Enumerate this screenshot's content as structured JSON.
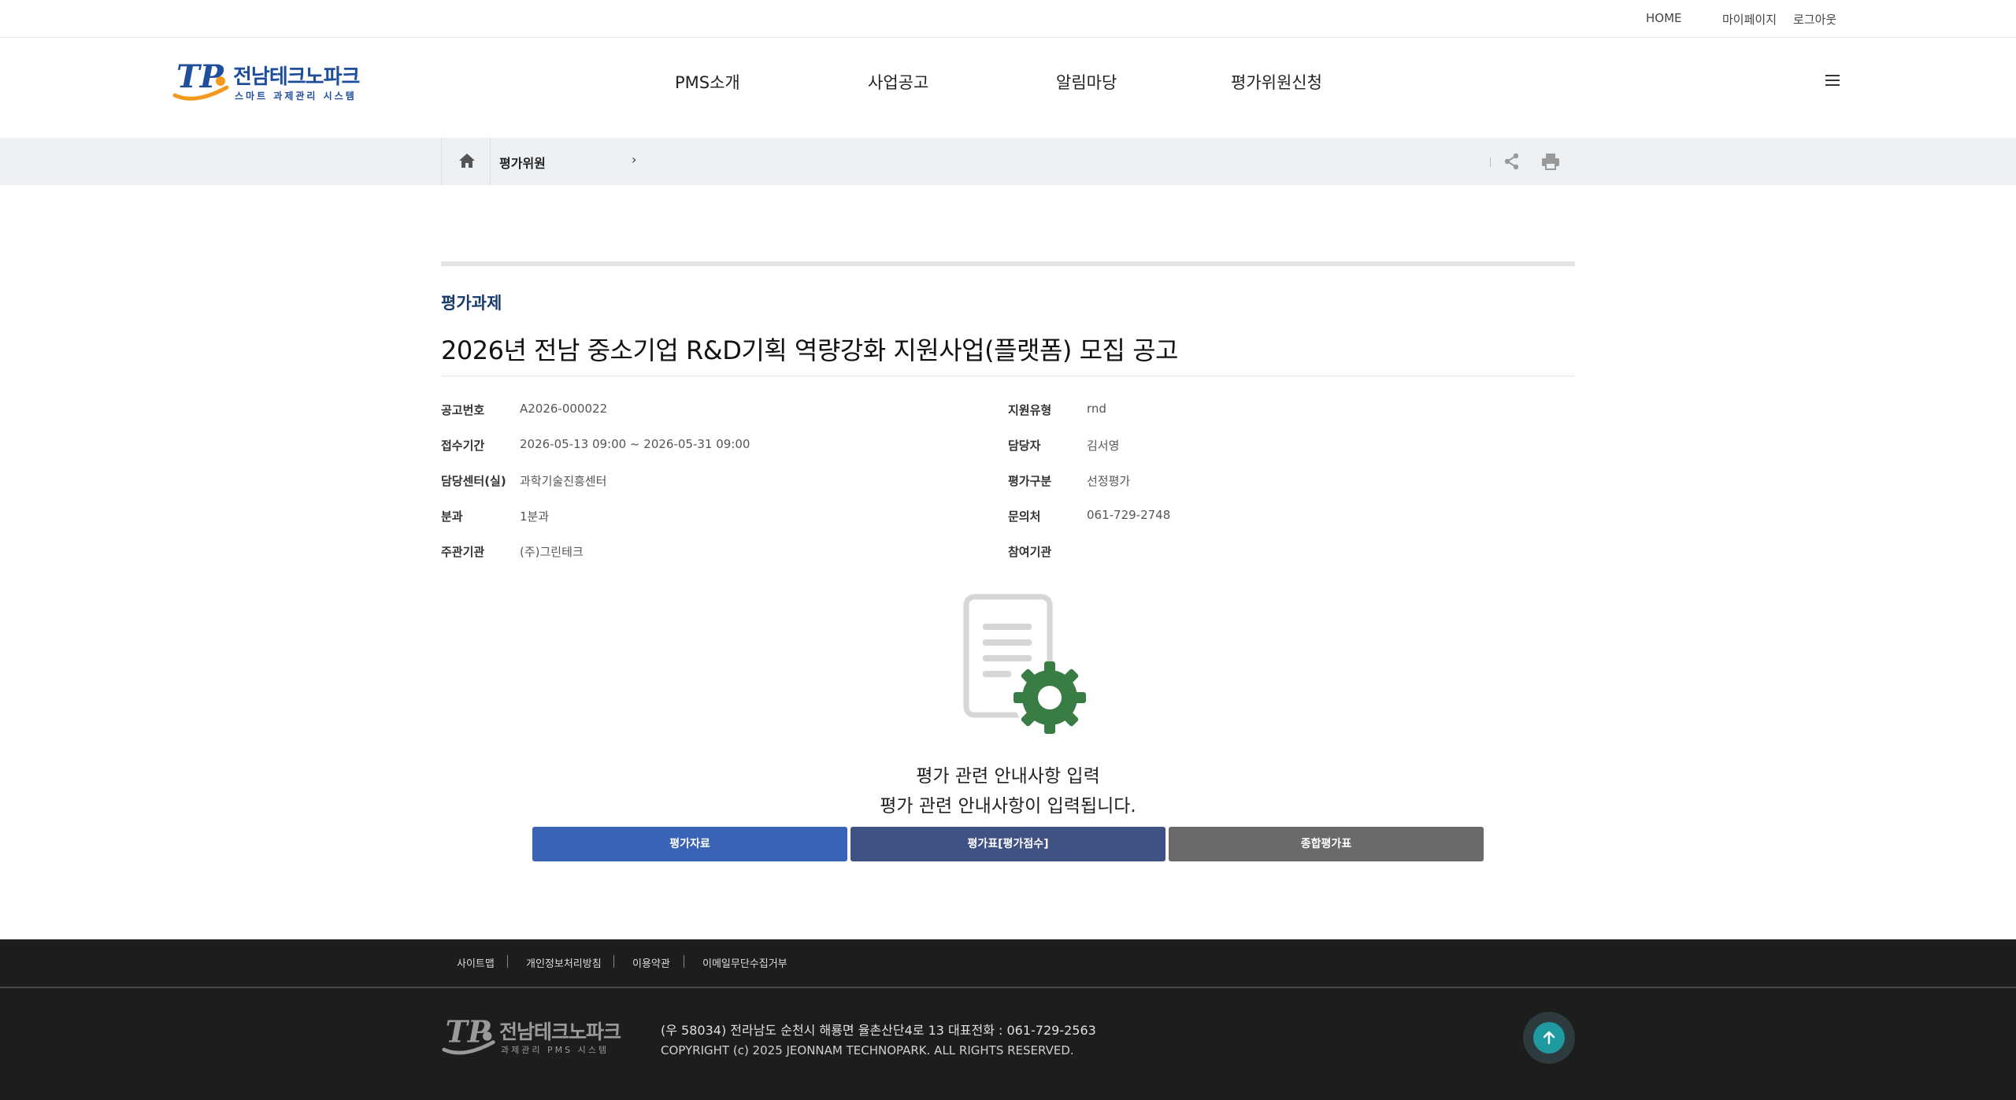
{
  "util_nav": {
    "home": "HOME",
    "mypage": "마이페이지",
    "logout": "로그아웃"
  },
  "logo": {
    "mark": "TP",
    "name": "전남테크노파크",
    "sub": "스마트 과제관리 시스템"
  },
  "gnb": [
    "PMS소개",
    "사업공고",
    "알림마당",
    "평가위원신청"
  ],
  "location": {
    "depth1": "평가위원",
    "arrow": "›"
  },
  "content": {
    "section_title": "평가과제",
    "title": "2026년 전남 중소기업 R&D기획 역량강화 지원사업(플랫폼) 모집 공고",
    "info_left": [
      {
        "label": "공고번호",
        "value": "A2026-000022"
      },
      {
        "label": "접수기간",
        "value": "2026-05-13 09:00 ~ 2026-05-31 09:00"
      },
      {
        "label": "담당센터(실)",
        "value": "과학기술진흥센터"
      },
      {
        "label": "분과",
        "value": "1분과"
      },
      {
        "label": "주관기관",
        "value": "(주)그린테크"
      }
    ],
    "info_right": [
      {
        "label": "지원유형",
        "value": "rnd"
      },
      {
        "label": "담당자",
        "value": "김서영"
      },
      {
        "label": "평가구분",
        "value": "선정평가"
      },
      {
        "label": "문의처",
        "value": "061-729-2748"
      },
      {
        "label": "참여기관",
        "value": ""
      }
    ],
    "guide_line1": "평가 관련 안내사항 입력",
    "guide_line2": "평가 관련 안내사항이 입력됩니다.",
    "buttons": [
      "평가자료",
      "평가표[평가점수]",
      "종합평가표"
    ]
  },
  "colors": {
    "brand_blue": "#1f4e9c",
    "brand_orange": "#f39a1e",
    "btn_primary": "#3a63b6",
    "btn_navy": "#3f5283",
    "btn_gray": "#6a6a6a",
    "gear_green": "#3a7d44",
    "footer_bg": "#1d1d1d",
    "top_btn": "#1e9aa0"
  },
  "icons": [
    "home-icon",
    "share-icon",
    "print-icon",
    "menu-icon",
    "document-gear-icon",
    "arrow-up-icon"
  ],
  "footer": {
    "links": [
      "사이트맵",
      "개인정보처리방침",
      "이용약관",
      "이메일무단수집거부"
    ],
    "logo_mark": "TP",
    "logo_name": "전남테크노파크",
    "logo_sub": "과제관리 PMS 시스템",
    "address": "(우 58034) 전라남도 순천시 해룡면 율촌산단4로 13   대표전화 : 061-729-2563",
    "copyright": "COPYRIGHT (c) 2025 JEONNAM TECHNOPARK. ALL RIGHTS RESERVED."
  }
}
